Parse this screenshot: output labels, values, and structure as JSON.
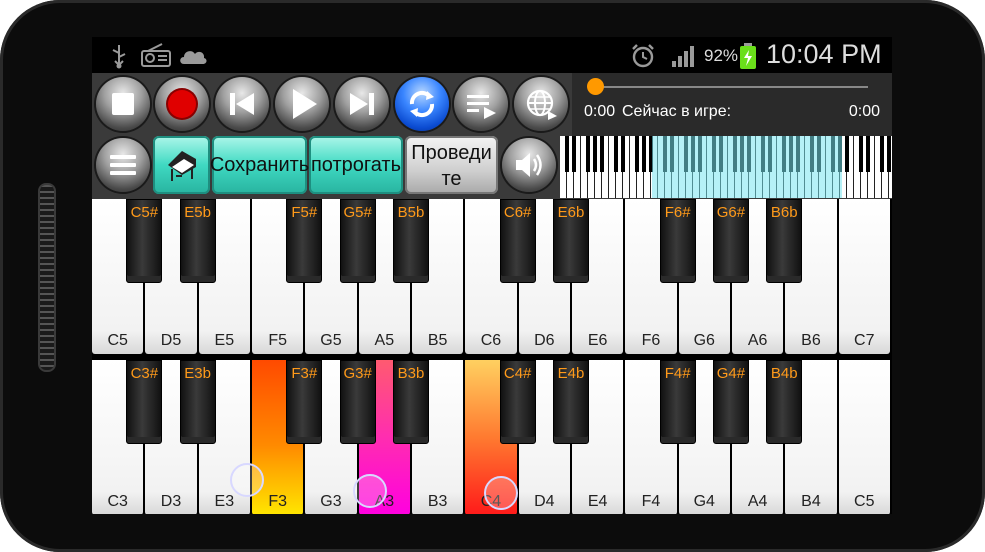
{
  "status_bar": {
    "icons_left": [
      "usb-icon",
      "radio-icon",
      "cloud-icon"
    ],
    "icons_right": [
      "alarm-icon",
      "signal-icon",
      "battery-icon"
    ],
    "battery_percent": "92%",
    "time": "10:04 PM"
  },
  "player": {
    "buttons": [
      "stop",
      "record",
      "previous",
      "play",
      "next",
      "loop",
      "playlist",
      "web"
    ],
    "current_time": "0:00",
    "playing_label": "Сейчас в игре:",
    "end_time": "0:00",
    "progress": 0
  },
  "toolbar": {
    "menu_icon": "menu-icon",
    "instrument_icon": "piano-icon",
    "save_label": "Сохранить",
    "touch_label": "потрогать",
    "swipe_label": "Проведите",
    "volume_icon": "speaker-icon"
  },
  "keyboard_upper": {
    "white_keys": [
      "C5",
      "D5",
      "E5",
      "F5",
      "G5",
      "A5",
      "B5",
      "C6",
      "D6",
      "E6",
      "F6",
      "G6",
      "A6",
      "B6",
      "C7"
    ],
    "black_keys": [
      "C5#",
      "E5b",
      "F5#",
      "G5#",
      "B5b",
      "C6#",
      "E6b",
      "F6#",
      "G6#",
      "B6b"
    ]
  },
  "keyboard_lower": {
    "white_keys": [
      "C3",
      "D3",
      "E3",
      "F3",
      "G3",
      "A3",
      "B3",
      "C4",
      "D4",
      "E4",
      "F4",
      "G4",
      "A4",
      "B4",
      "C5"
    ],
    "black_keys": [
      "C3#",
      "E3b",
      "F3#",
      "G3#",
      "B3b",
      "C4#",
      "E4b",
      "F4#",
      "G4#",
      "B4b"
    ],
    "pressed_keys": [
      "F3",
      "A3",
      "C4"
    ]
  },
  "colors": {
    "accent_orange": "#ff9a1a",
    "teal_button": "#3fd9c2",
    "pressed_F3": "#ff6a00",
    "pressed_A3": "#ff1fb0",
    "pressed_C4": "#ff4040"
  }
}
